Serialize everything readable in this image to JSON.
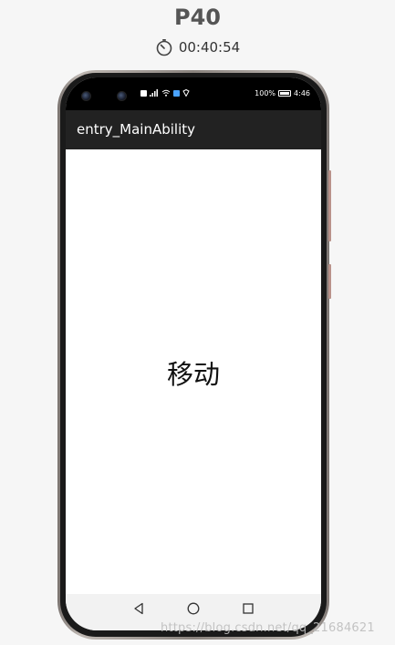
{
  "header": {
    "device_name": "P40",
    "timer_icon": "stopwatch-icon",
    "elapsed_time": "00:40:54"
  },
  "status_bar": {
    "left_indicators": [
      "HD",
      "4G",
      "wifi-icon",
      "app-notification-icon",
      "shield-icon"
    ],
    "battery_percent": "100%",
    "time": "4:46"
  },
  "app_bar": {
    "title": "entry_MainAbility"
  },
  "content": {
    "center_text": "移动"
  },
  "nav_bar": {
    "back_icon": "back-triangle-icon",
    "home_icon": "home-circle-icon",
    "recents_icon": "recents-square-icon"
  },
  "watermark": {
    "text": "https://blog.csdn.net/qq_21684621"
  }
}
